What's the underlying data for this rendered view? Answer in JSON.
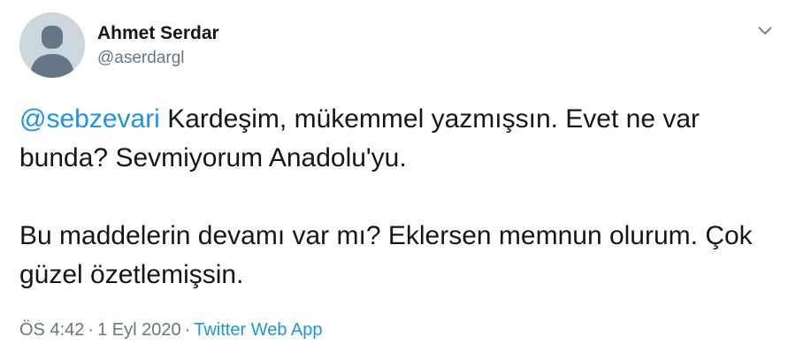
{
  "author": {
    "name": "Ahmet Serdar",
    "handle": "@aserdargl"
  },
  "tweet": {
    "mention": "@sebzevari",
    "line1_rest": " Kardeşim, mükemmel yazmışsın. Evet ne var bunda? Sevmiyorum Anadolu'yu.",
    "paragraph2": "Bu maddelerin devamı var mı? Eklersen memnun olurum. Çok güzel özetlemişsin."
  },
  "meta": {
    "time": "ÖS 4:42",
    "separator": "·",
    "date": "1 Eyl 2020",
    "source": "Twitter Web App"
  },
  "icons": {
    "avatar": "default-avatar-icon",
    "caret": "chevron-down-icon"
  },
  "colors": {
    "link": "#1b95e0",
    "secondary_text": "#657786",
    "primary_text": "#14171a",
    "avatar_bg": "#ccd6dd"
  }
}
